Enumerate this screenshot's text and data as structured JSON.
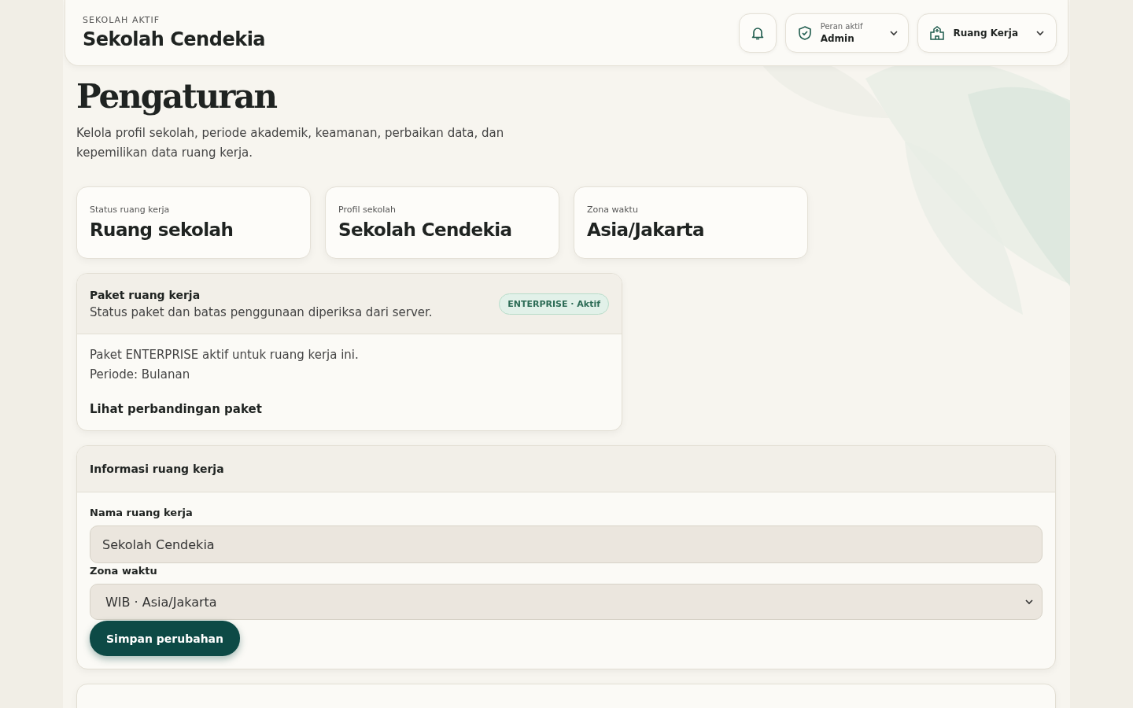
{
  "header": {
    "eyebrow": "SEKOLAH AKTIF",
    "school": "Sekolah Cendekia",
    "role": {
      "label": "Peran aktif",
      "value": "Admin"
    },
    "workspace": "Ruang Kerja"
  },
  "page": {
    "title": "Pengaturan",
    "description": "Kelola profil sekolah, periode akademik, keamanan, perbaikan data, dan kepemilikan data ruang kerja."
  },
  "stats": [
    {
      "label": "Status ruang kerja",
      "value": "Ruang sekolah"
    },
    {
      "label": "Profil sekolah",
      "value": "Sekolah Cendekia"
    },
    {
      "label": "Zona waktu",
      "value": "Asia/Jakarta"
    }
  ],
  "plan": {
    "title": "Paket ruang kerja",
    "subtitle": "Status paket dan batas penggunaan diperiksa dari server.",
    "badge": "ENTERPRISE · Aktif",
    "lines": [
      "Paket ENTERPRISE aktif untuk ruang kerja ini.",
      "Periode: Bulanan"
    ],
    "link": "Lihat perbandingan paket"
  },
  "workspace_info": {
    "title": "Informasi ruang kerja",
    "name_label": "Nama ruang kerja",
    "name_value": "Sekolah Cendekia",
    "tz_label": "Zona waktu",
    "tz_value": "WIB · Asia/Jakarta",
    "save": "Simpan perubahan"
  }
}
